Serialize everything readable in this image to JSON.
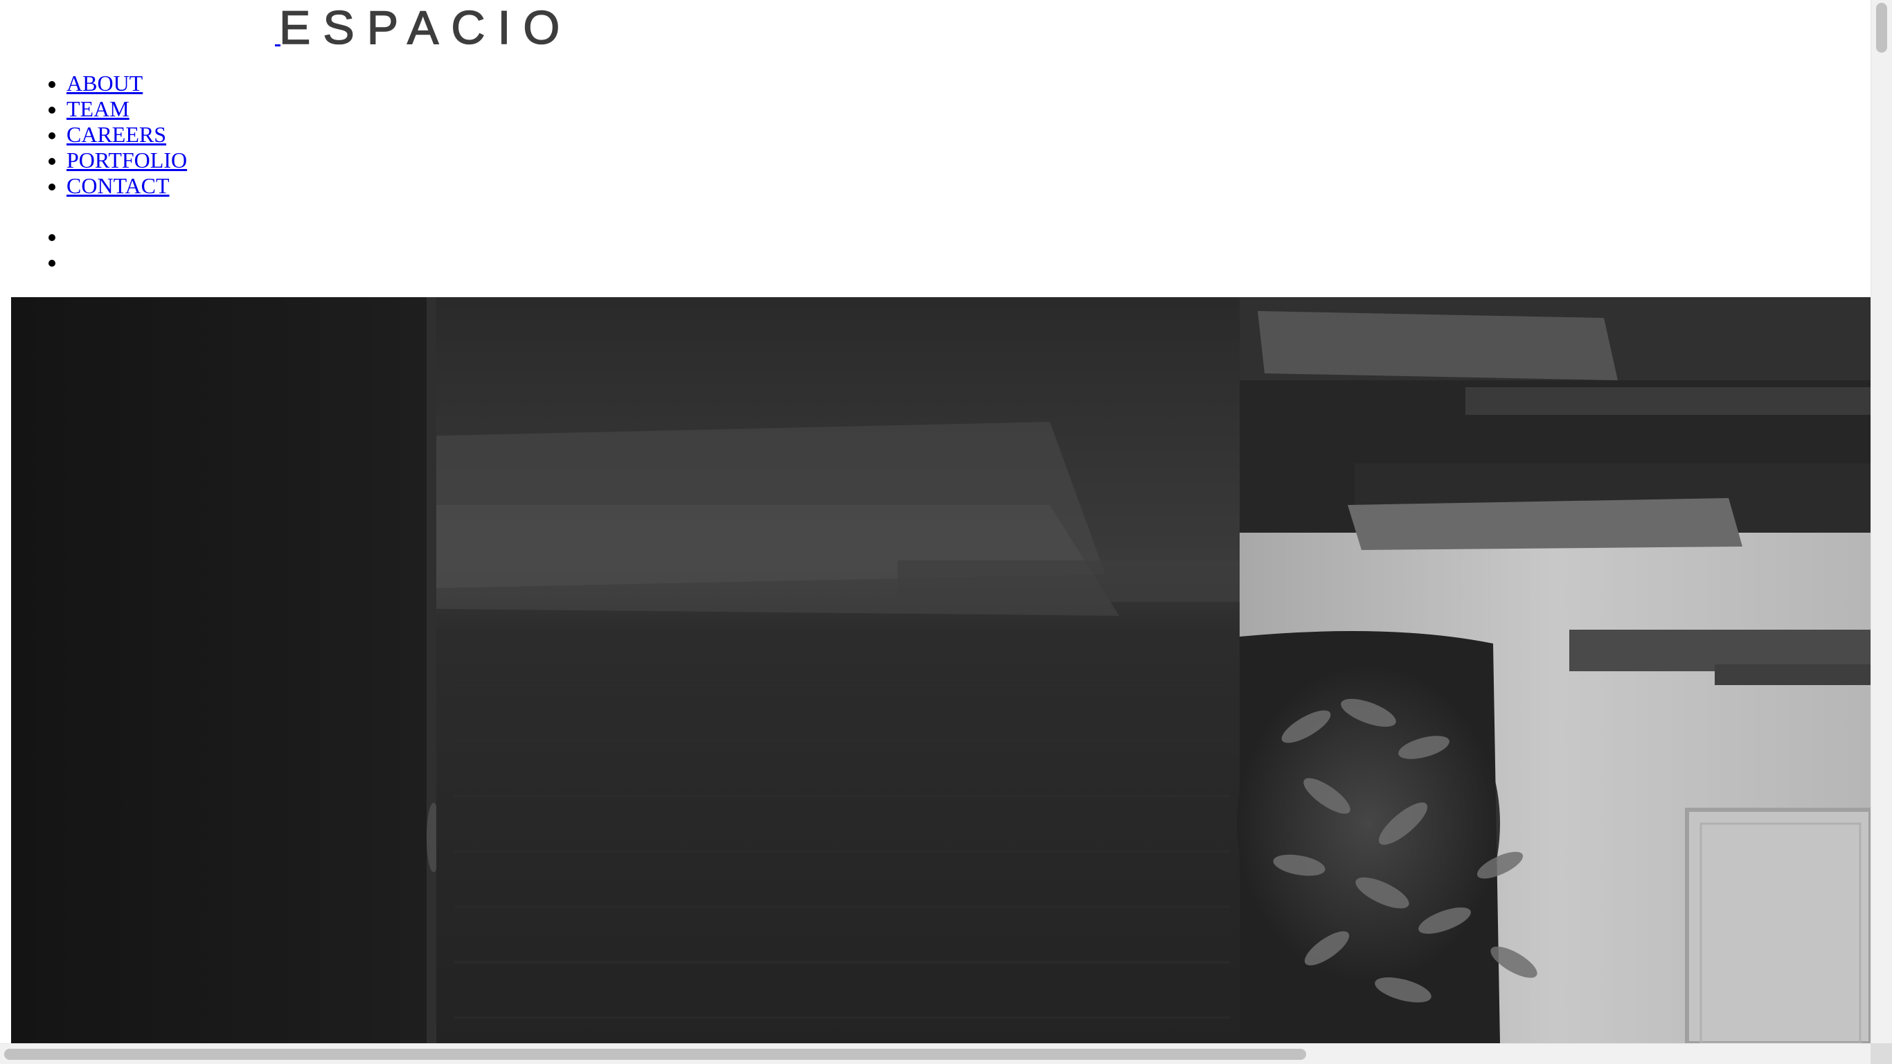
{
  "header": {
    "logo_text": "ESPACIO",
    "logo_color": "#3d3d3d"
  },
  "nav": {
    "items": [
      {
        "label": "ABOUT"
      },
      {
        "label": "TEAM"
      },
      {
        "label": "CAREERS"
      },
      {
        "label": "PORTFOLIO"
      },
      {
        "label": "CONTACT"
      }
    ]
  },
  "social": {
    "items": [
      {
        "label": ""
      },
      {
        "label": ""
      }
    ]
  },
  "hero": {
    "media": "office-interior-video"
  },
  "colors": {
    "link": "#0000ee",
    "scrollbar_track": "#f1f1f1",
    "scrollbar_thumb": "#c1c1c1"
  }
}
